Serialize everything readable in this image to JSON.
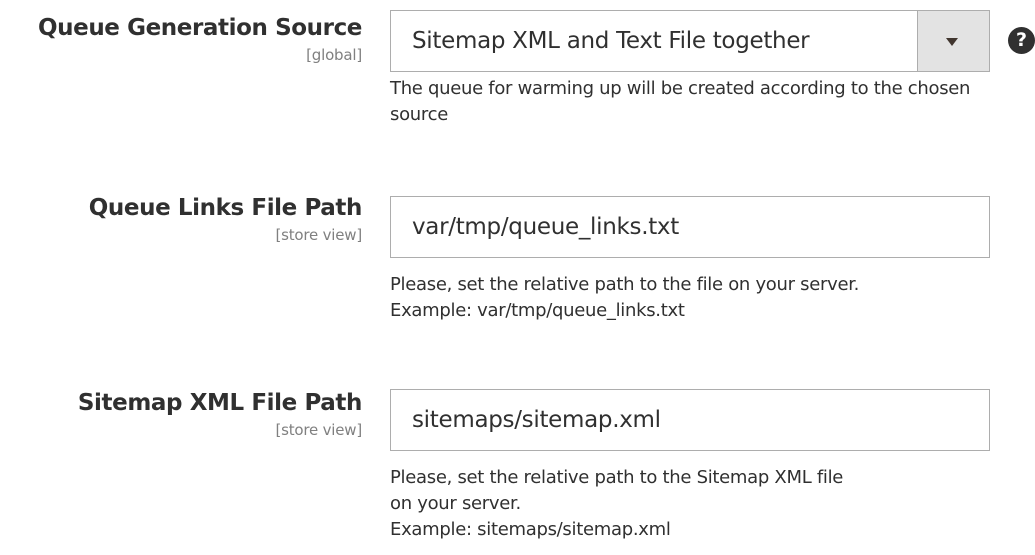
{
  "fields": [
    {
      "label": "Queue Generation Source",
      "scope": "[global]",
      "value": "Sitemap XML and Text File together",
      "note": "The queue for warming up will be created according to the chosen source",
      "help_icon": "?"
    },
    {
      "label": "Queue Links File Path",
      "scope": "[store view]",
      "value": "var/tmp/queue_links.txt",
      "note_lines": [
        "Please, set the relative path to the file on your server.",
        "Example: var/tmp/queue_links.txt"
      ]
    },
    {
      "label": "Sitemap XML File Path",
      "scope": "[store view]",
      "value": "sitemaps/sitemap.xml",
      "note_lines": [
        "Please, set the relative path to the Sitemap XML file",
        "on your server.",
        "Example: sitemaps/sitemap.xml"
      ]
    }
  ],
  "icons": {
    "select_arrow": "chevron-down-icon",
    "help": "question-circle-icon"
  },
  "colors": {
    "text": "#303030",
    "scope": "#808080",
    "border": "#adadad",
    "arrow_bg": "#e3e3e3"
  }
}
